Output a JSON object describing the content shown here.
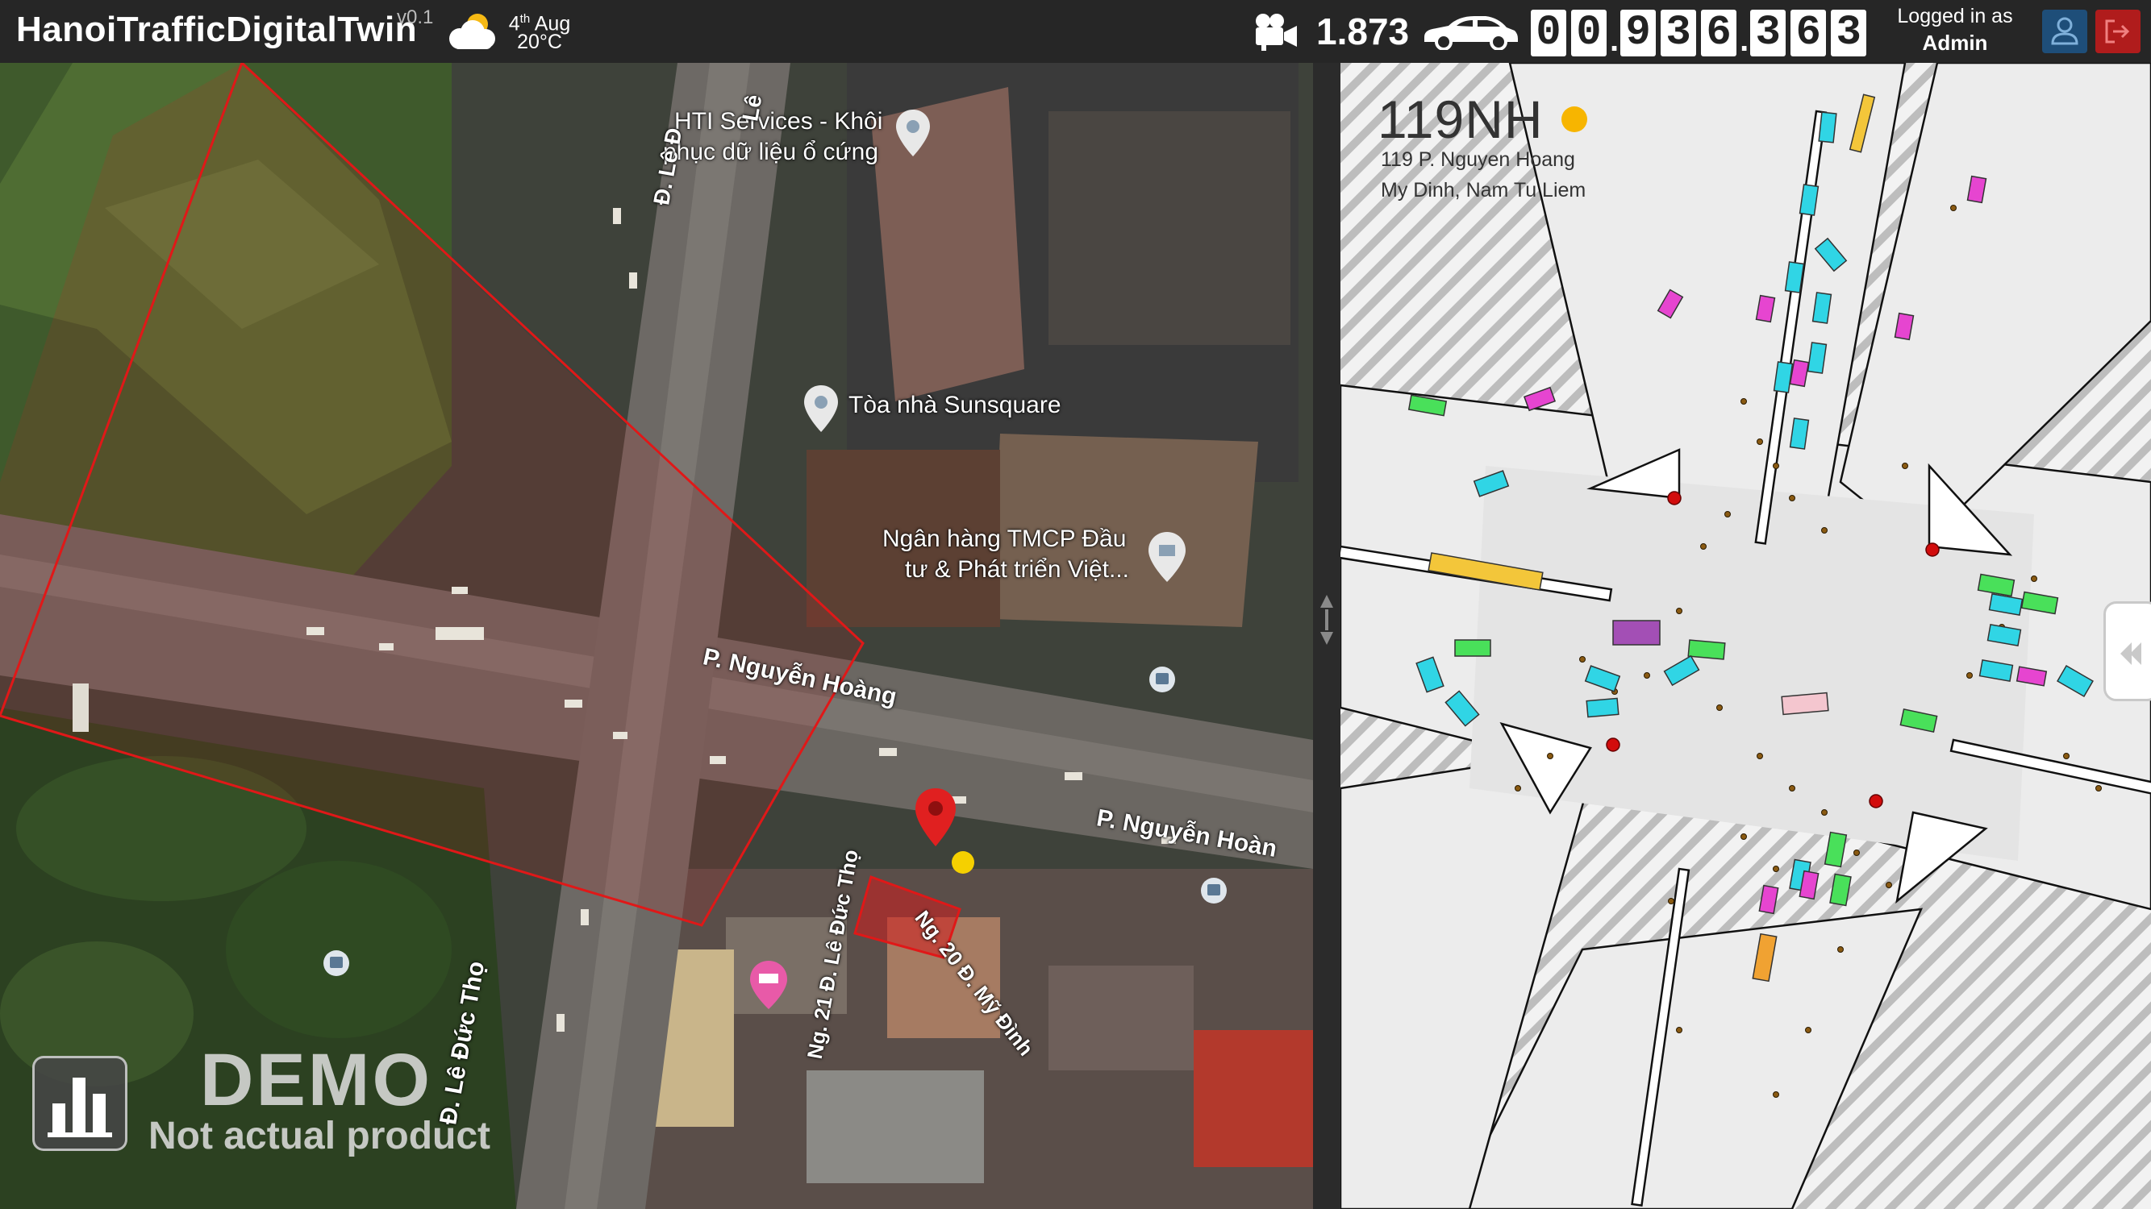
{
  "header": {
    "app_title": "HanoiTrafficDigitalTwin",
    "version": "v0.1",
    "weather": {
      "icon": "partly-cloudy-icon",
      "date_day": "4",
      "date_suffix": "th",
      "date_month": "Aug",
      "temperature": "20°C"
    },
    "camera": {
      "icon": "video-camera-icon",
      "count": "1.873"
    },
    "vehicle_counter": {
      "icon": "car-icon",
      "digits": [
        "0",
        "0",
        "9",
        "3",
        "6",
        "3",
        "6",
        "3"
      ]
    },
    "login": {
      "label": "Logged in as",
      "user": "Admin"
    },
    "buttons": {
      "profile_icon": "user-icon",
      "logout_icon": "logout-icon"
    },
    "colors": {
      "bar": "#262626",
      "profile": "#1e4e79",
      "logout": "#b01c1c"
    }
  },
  "map": {
    "pois": [
      {
        "name": "HTI Services - Khôi",
        "line2": "phục dữ liệu ổ cứng",
        "icon": "place-pin-icon"
      },
      {
        "name": "Tòa nhà Sunsquare",
        "icon": "place-pin-icon"
      },
      {
        "name": "Ngân hàng TMCP Đầu",
        "line2": "tư & Phát triển Việt...",
        "icon": "bank-icon"
      }
    ],
    "streets": [
      {
        "label": "P. Nguyễn Hoàng"
      },
      {
        "label": "P. Nguyễn Hoàn"
      },
      {
        "label": "Đ. Lê Đức Thọ"
      },
      {
        "label": "Ng. 21 Đ. Lê Đức Thọ"
      },
      {
        "label": "Ng. 20 Đ. Mỹ Đình"
      },
      {
        "label": "Đ. Lê Đ"
      },
      {
        "label": "Lê"
      }
    ],
    "selected_location_icon": "map-marker-icon",
    "demo_title": "DEMO",
    "demo_subtitle": "Not actual product",
    "stats_button_icon": "bar-chart-icon",
    "colors": {
      "zone_outline": "#e01818",
      "marker": "#e02020",
      "status_dot": "#f5d000"
    }
  },
  "splitter": {
    "handle_icon": "drag-handle-icon"
  },
  "simulation": {
    "junction_id": "119NH",
    "status_color": "#f7b500",
    "address_line1": "119 P. Nguyen Hoang",
    "address_line2": "My Dinh, Nam Tu Liem",
    "collapse_icon": "double-chevron-left-icon",
    "vehicle_colors": [
      "#30d5e5",
      "#e645d0",
      "#49e05a",
      "#f3c63a",
      "#f0a232",
      "#a34fb5",
      "#f4c6cf"
    ],
    "pedestrian_color": "#8a5a12",
    "signal_color": "#d20c0c"
  }
}
